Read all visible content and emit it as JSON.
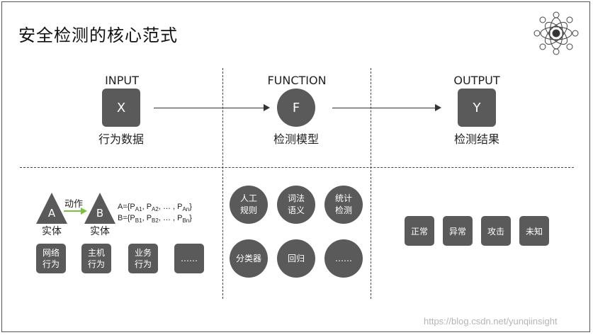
{
  "title": "安全检测的核心范式",
  "columns": [
    {
      "header": "INPUT",
      "symbol": "X",
      "label": "行为数据"
    },
    {
      "header": "FUNCTION",
      "symbol": "F",
      "label": "检测模型"
    },
    {
      "header": "OUTPUT",
      "symbol": "Y",
      "label": "检测结果"
    }
  ],
  "input_panel": {
    "entity_a": "A",
    "entity_b": "B",
    "entity_label": "实体",
    "action_label": "动作",
    "formula_a": {
      "prefix": "A={P",
      "s1": "A1",
      "sep1": ", P",
      "s2": "A2",
      "sep2": ", … , P",
      "s3": "An",
      "suffix": "}"
    },
    "formula_b": {
      "prefix": "B={P",
      "s1": "B1",
      "sep1": ", P",
      "s2": "B2",
      "sep2": ", … , P",
      "s3": "Bn",
      "suffix": "}"
    },
    "boxes": [
      {
        "line1": "网络",
        "line2": "行为"
      },
      {
        "line1": "主机",
        "line2": "行为"
      },
      {
        "line1": "业务",
        "line2": "行为"
      },
      {
        "line1": "……",
        "line2": ""
      }
    ],
    "action_arrow_color": "#7cc242"
  },
  "function_panel": {
    "circles": [
      {
        "line1": "人工",
        "line2": "规则"
      },
      {
        "line1": "词法",
        "line2": "语义"
      },
      {
        "line1": "统计",
        "line2": "检测"
      },
      {
        "line1": "分类器",
        "line2": ""
      },
      {
        "line1": "回归",
        "line2": ""
      },
      {
        "line1": "……",
        "line2": ""
      }
    ]
  },
  "output_panel": {
    "boxes": [
      "正常",
      "异常",
      "攻击",
      "未知"
    ]
  },
  "watermark": "https://blog.csdn.net/yunqiinsight",
  "colors": {
    "shape_fill": "#5a5a5a",
    "text": "#222222"
  }
}
